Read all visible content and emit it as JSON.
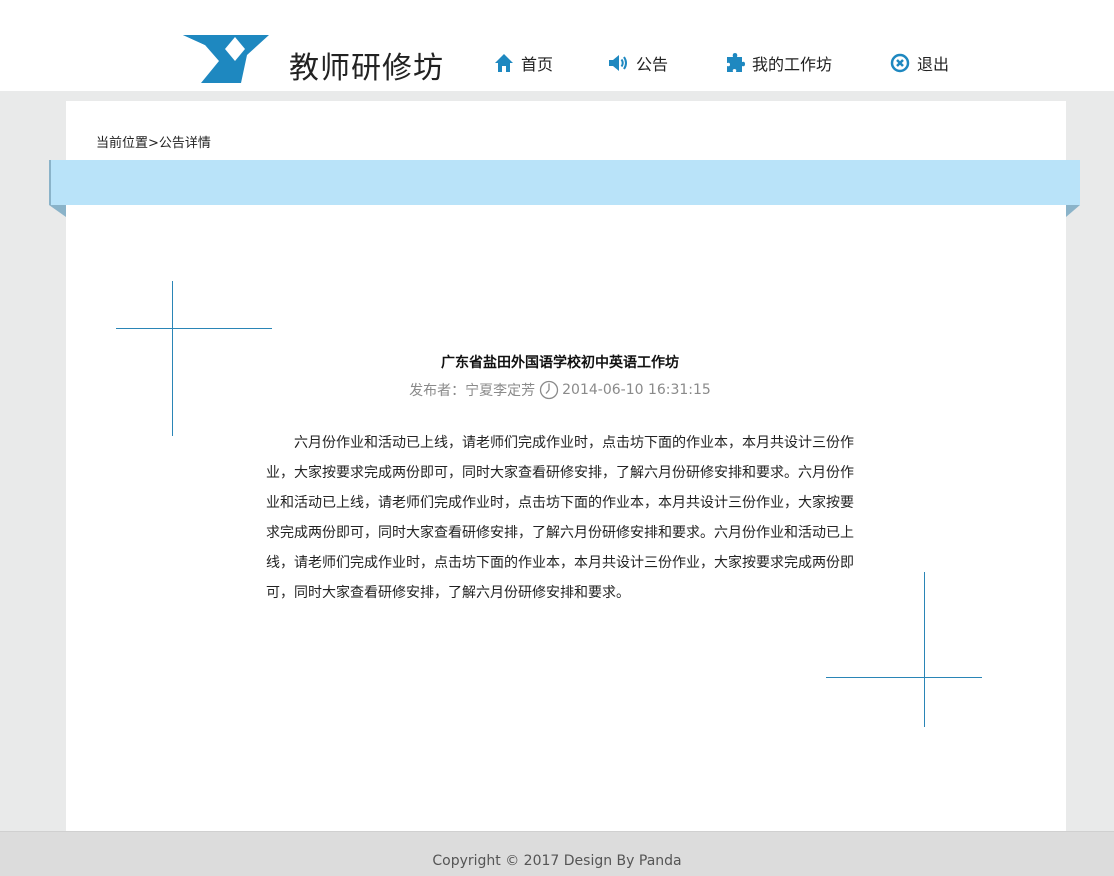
{
  "header": {
    "site_title": "教师研修坊",
    "nav": [
      {
        "label": "首页",
        "icon": "home-icon"
      },
      {
        "label": "公告",
        "icon": "speaker-icon"
      },
      {
        "label": "我的工作坊",
        "icon": "puzzle-icon"
      },
      {
        "label": "退出",
        "icon": "close-circle-icon"
      }
    ]
  },
  "breadcrumb": "当前位置>公告详情",
  "article": {
    "title": "广东省盐田外国语学校初中英语工作坊",
    "publisher": "发布者：宁夏李定芳",
    "datetime": "2014-06-10 16:31:15",
    "body": "六月份作业和活动已上线，请老师们完成作业时，点击坊下面的作业本，本月共设计三份作业，大家按要求完成两份即可，同时大家查看研修安排，了解六月份研修安排和要求。六月份作业和活动已上线，请老师们完成作业时，点击坊下面的作业本，本月共设计三份作业，大家按要求完成两份即可，同时大家查看研修安排，了解六月份研修安排和要求。六月份作业和活动已上线，请老师们完成作业时，点击坊下面的作业本，本月共设计三份作业，大家按要求完成两份即可，同时大家查看研修安排，了解六月份研修安排和要求。"
  },
  "footer": {
    "copyright": "Copyright © 2017 Design By Panda"
  },
  "colors": {
    "accent": "#2a85b6",
    "ribbon": "#b9e3f9",
    "background": "#e9eaea"
  }
}
